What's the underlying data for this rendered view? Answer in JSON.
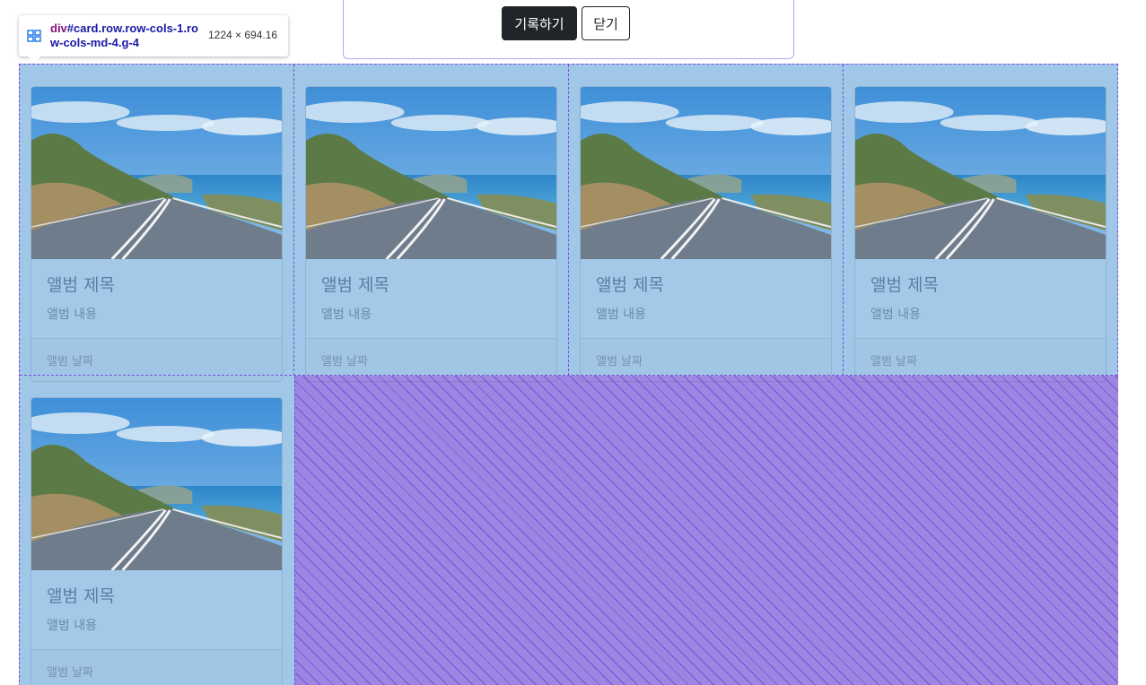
{
  "form": {
    "submit_label": "기록하기",
    "close_label": "닫기"
  },
  "devtools_tooltip": {
    "tag": "div",
    "selector": "#card.row.row-cols-1.row-cols-md-4.g-4",
    "size": "1224 × 694.16"
  },
  "cards": [
    {
      "title": "앨범 제목",
      "text": "앨범 내용",
      "date": "앨범 날짜"
    },
    {
      "title": "앨범 제목",
      "text": "앨범 내용",
      "date": "앨범 날짜"
    },
    {
      "title": "앨범 제목",
      "text": "앨범 내용",
      "date": "앨범 날짜"
    },
    {
      "title": "앨범 제목",
      "text": "앨범 내용",
      "date": "앨범 날짜"
    },
    {
      "title": "앨범 제목",
      "text": "앨범 내용",
      "date": "앨범 날짜"
    }
  ],
  "colors": {
    "button_dark": "#212529",
    "grid_overlay": "#6fa8dc",
    "grid_gap_overlay": "#9d86e2",
    "grid_lines": "#7b4fe0"
  }
}
